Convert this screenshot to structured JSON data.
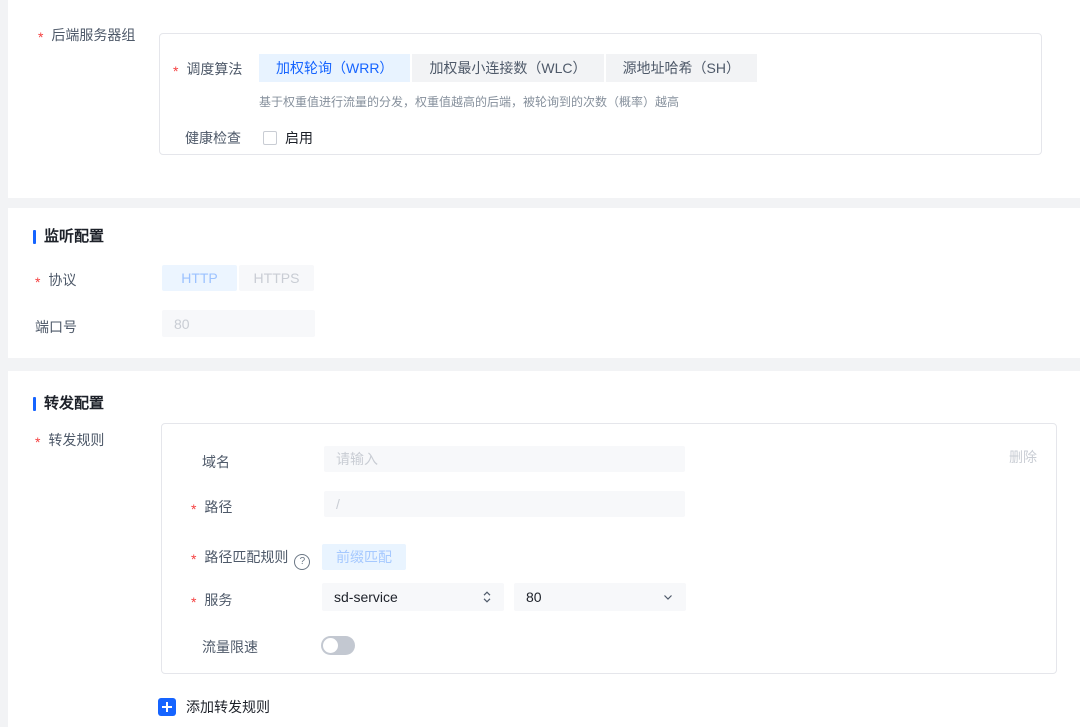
{
  "colors": {
    "primary": "#1664ff",
    "primary_light_bg": "#e8f3ff",
    "required_star": "#f53f3f",
    "page_bg": "#f2f3f5",
    "input_bg": "#f7f8fa",
    "border": "#e5e6eb",
    "disabled_text": "#c9cdd4"
  },
  "backend_group": {
    "label": "后端服务器组",
    "scheduling": {
      "label": "调度算法",
      "tabs": [
        {
          "label": "加权轮询（WRR）",
          "selected": true
        },
        {
          "label": "加权最小连接数（WLC）",
          "selected": false
        },
        {
          "label": "源地址哈希（SH）",
          "selected": false
        }
      ],
      "description": "基于权重值进行流量的分发，权重值越高的后端，被轮询到的次数（概率）越高"
    },
    "health_check": {
      "label": "健康检查",
      "checkbox_label": "启用",
      "checked": false
    }
  },
  "listener": {
    "title": "监听配置",
    "protocol": {
      "label": "协议",
      "options": [
        {
          "label": "HTTP",
          "selected": true
        },
        {
          "label": "HTTPS",
          "selected": false
        }
      ]
    },
    "port": {
      "label": "端口号",
      "value": "80"
    }
  },
  "forwarding": {
    "title": "转发配置",
    "rules_label": "转发规则",
    "rule": {
      "delete_label": "删除",
      "domain": {
        "label": "域名",
        "placeholder": "请输入"
      },
      "path": {
        "label": "路径",
        "placeholder": "/"
      },
      "path_match": {
        "label": "路径匹配规则",
        "value": "前缀匹配"
      },
      "service": {
        "label": "服务",
        "name": "sd-service",
        "port": "80"
      },
      "rate_limit": {
        "label": "流量限速",
        "enabled": false
      }
    },
    "add_rule_label": "添加转发规则"
  }
}
